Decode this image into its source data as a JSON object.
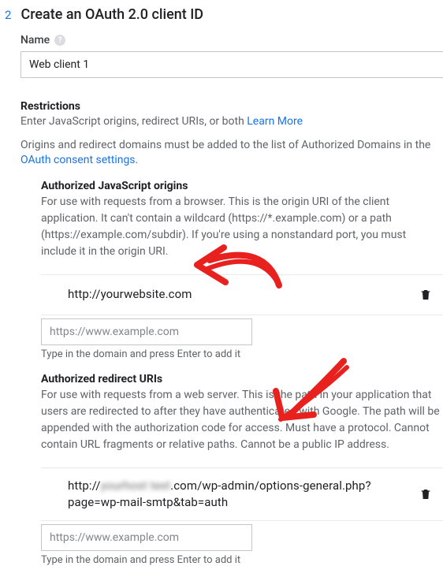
{
  "step_number": "2",
  "page_title": "Create an OAuth 2.0 client ID",
  "name": {
    "label": "Name",
    "help_glyph": "?",
    "value": "Web client 1"
  },
  "restrictions": {
    "heading": "Restrictions",
    "intro_prefix": "Enter JavaScript origins, redirect URIs, or both ",
    "learn_more": "Learn More",
    "domains_text_before": "Origins and redirect domains must be added to the list of Authorized Domains in the ",
    "consent_link": "OAuth consent settings",
    "dot": "."
  },
  "origins": {
    "heading": "Authorized JavaScript origins",
    "description": "For use with requests from a browser. This is the origin URI of the client application. It can't contain a wildcard (https://*.example.com) or a path (https://example.com/subdir). If you're using a nonstandard port, you must include it in the origin URI.",
    "items": [
      {
        "value": "http://yourwebsite.com"
      }
    ],
    "placeholder": "https://www.example.com",
    "hint": "Type in the domain and press Enter to add it"
  },
  "redirects": {
    "heading": "Authorized redirect URIs",
    "description": "For use with requests from a web server. This is the path in your application that users are redirected to after they have authenticated with Google. The path will be appended with the authorization code for access. Must have a protocol. Cannot contain URL fragments or relative paths. Cannot be a public IP address.",
    "items": [
      {
        "prefix": "http://",
        "blurred": "yourhost text",
        "suffix": ".com/wp-admin/options-general.php?page=wp-mail-smtp&tab=auth"
      }
    ],
    "placeholder": "https://www.example.com",
    "hint": "Type in the domain and press Enter to add it"
  },
  "colors": {
    "accent": "#1a73e8",
    "annotation": "#e8201e"
  }
}
